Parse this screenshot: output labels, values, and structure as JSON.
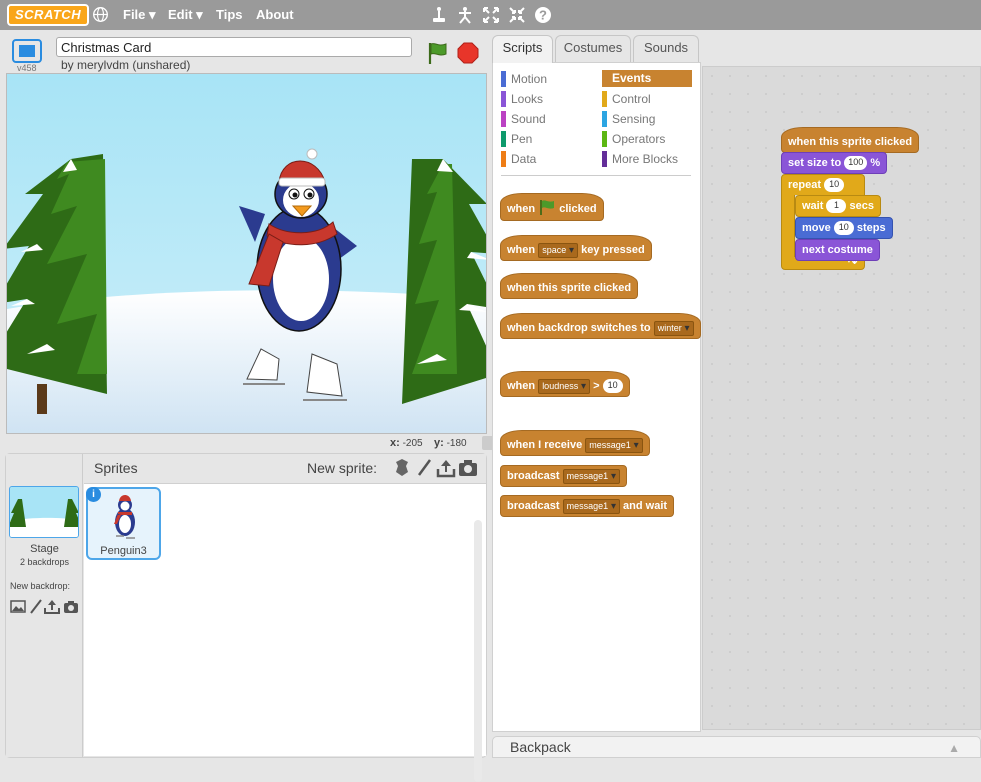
{
  "menu": {
    "logo": "SCRATCH",
    "file": "File ▾",
    "edit": "Edit ▾",
    "tips": "Tips",
    "about": "About",
    "icons": [
      "globe-icon",
      "duplicate-icon",
      "cut-icon",
      "grow-icon",
      "shrink-icon",
      "help-icon"
    ]
  },
  "project": {
    "title": "Christmas Card",
    "author": "by merylvdm (unshared)",
    "version": "v458"
  },
  "stage": {
    "x_label": "x:",
    "x_value": "-205",
    "y_label": "y:",
    "y_value": "-180"
  },
  "sprites": {
    "title": "Sprites",
    "new_sprite": "New sprite:",
    "stage_label": "Stage",
    "stage_sub": "2 backdrops",
    "new_backdrop": "New backdrop:",
    "sprite_list": [
      "Penguin3"
    ]
  },
  "tabs": [
    "Scripts",
    "Costumes",
    "Sounds"
  ],
  "categories": {
    "left": [
      {
        "label": "Motion",
        "color": "#4a6cd4"
      },
      {
        "label": "Looks",
        "color": "#8a55d7"
      },
      {
        "label": "Sound",
        "color": "#bb42c3"
      },
      {
        "label": "Pen",
        "color": "#0e9a6c"
      },
      {
        "label": "Data",
        "color": "#ee7d16"
      }
    ],
    "right": [
      {
        "label": "Events",
        "color": "#c88330"
      },
      {
        "label": "Control",
        "color": "#e1a91a"
      },
      {
        "label": "Sensing",
        "color": "#2ca5e2"
      },
      {
        "label": "Operators",
        "color": "#5cb712"
      },
      {
        "label": "More Blocks",
        "color": "#632d99"
      }
    ]
  },
  "palette_blocks": {
    "when_flag_a": "when",
    "when_flag_b": "clicked",
    "key_a": "when",
    "key_drop": "space",
    "key_b": "key pressed",
    "sprite_clicked": "when this sprite clicked",
    "backdrop_a": "when backdrop switches to",
    "backdrop_drop": "winter",
    "loudness_a": "when",
    "loudness_drop": "loudness",
    "loudness_op": ">",
    "loudness_val": "10",
    "receive_a": "when I receive",
    "receive_drop": "message1",
    "broadcast_a": "broadcast",
    "broadcast_drop": "message1",
    "broadcast_wait_a": "broadcast",
    "broadcast_wait_drop": "message1",
    "broadcast_wait_b": "and wait"
  },
  "script": {
    "hat": "when this sprite clicked",
    "set_size_a": "set size to",
    "set_size_val": "100",
    "set_size_b": "%",
    "repeat_a": "repeat",
    "repeat_val": "10",
    "wait_a": "wait",
    "wait_val": "1",
    "wait_b": "secs",
    "move_a": "move",
    "move_val": "10",
    "move_b": "steps",
    "next_costume": "next costume"
  },
  "backpack": {
    "label": "Backpack",
    "arrow": "▲"
  },
  "colors": {
    "events": "#c88330",
    "looks": "#8a55d7",
    "motion": "#4a6cd4",
    "control": "#e1a91a",
    "selection": "#4da6e9"
  }
}
